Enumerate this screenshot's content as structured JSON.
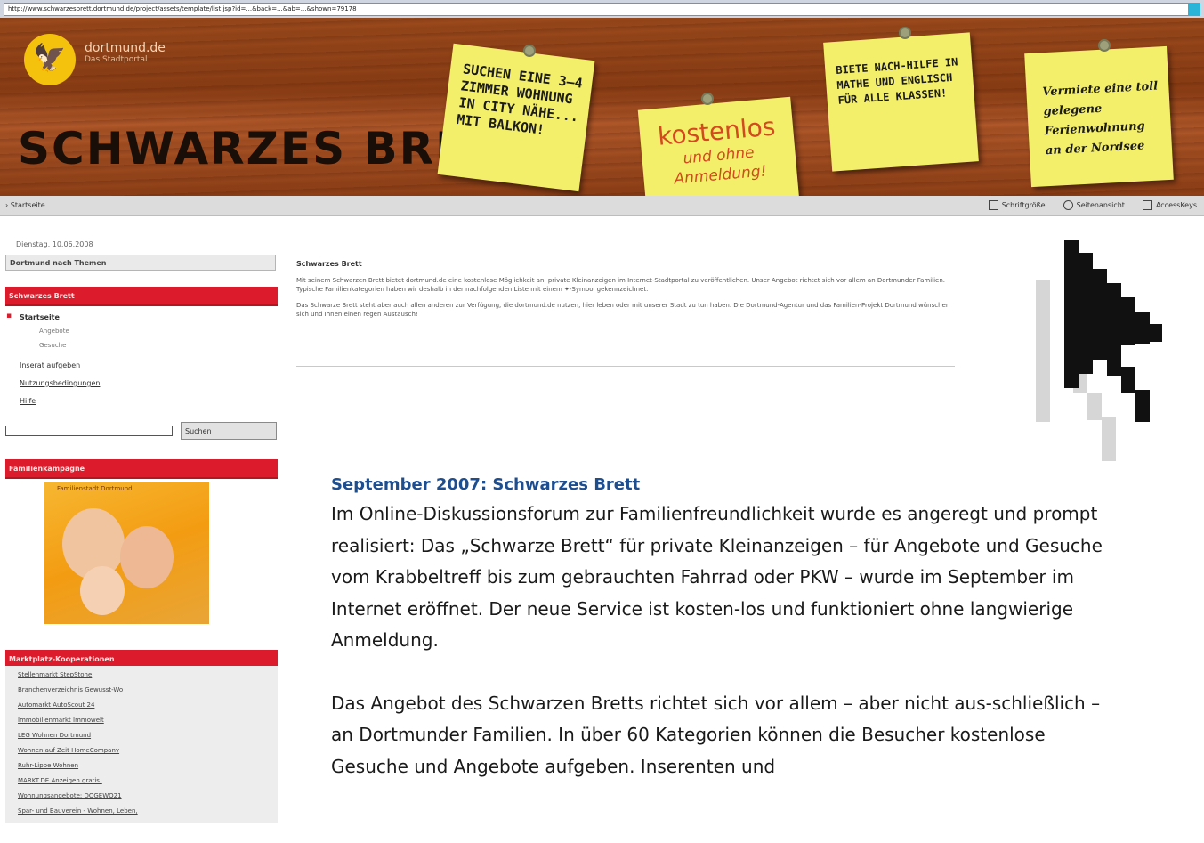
{
  "url": "http://www.schwarzesbrett.dortmund.de/project/assets/template/list.jsp?id=...&back=...&ab=...&shown=79178",
  "banner": {
    "site": "dortmund.de",
    "site_sub": "Das Stadtportal",
    "title": "SCHWARZES BRETT",
    "note1": "SUCHEN EINE 3–4 ZIMMER WOHNUNG IN CITY NÄHE... MIT BALKON!",
    "note2_big": "kostenlos",
    "note2_small": "und ohne Anmeldung!",
    "note3": "BIETE NACH-HILFE IN MATHE UND ENGLISCH FÜR ALLE KLASSEN!",
    "note4": "Vermiete eine toll gelegene Ferienwohnung an der Nordsee"
  },
  "navbar": {
    "home": "› Startseite",
    "font_size": "Schriftgröße",
    "contrast": "Seitenansicht",
    "access": "AccessKeys"
  },
  "left": {
    "date": "Dienstag, 10.06.2008",
    "topics": "Dortmund nach Themen",
    "section": "Schwarzes Brett",
    "nav": [
      "Startseite",
      "Angebote",
      "Gesuche",
      "Inserat aufgeben",
      "Nutzungsbedingungen",
      "Hilfe"
    ],
    "search_button": "Suchen",
    "campaign": "Familienkampagne",
    "campaign_img_label": "Familienstadt Dortmund",
    "market": "Marktplatz-Kooperationen",
    "market_links": [
      "Stellenmarkt StepStone",
      "Branchenverzeichnis Gewusst-Wo",
      "Automarkt AutoScout 24",
      "Immobilienmarkt Immowelt",
      "LEG Wohnen Dortmund",
      "Wohnen auf Zeit HomeCompany",
      "Ruhr-Lippe Wohnen",
      "MARKT.DE Anzeigen gratis!",
      "Wohnungsangebote: DOGEWO21",
      "Spar- und Bauverein - Wohnen, Leben,"
    ]
  },
  "main": {
    "heading": "Schwarzes Brett",
    "para1": "Mit seinem Schwarzen Brett bietet dortmund.de eine kostenlose Möglichkeit an, private Kleinanzeigen im Internet-Stadtportal zu veröffentlichen. Unser Angebot richtet sich vor allem an Dortmunder Familien. Typische Familienkategorien haben wir deshalb in der nachfolgenden Liste mit einem ✦-Symbol gekennzeichnet.",
    "para2": "Das Schwarze Brett steht aber auch allen anderen zur Verfügung, die dortmund.de nutzen, hier leben oder mit unserer Stadt zu tun haben. Die Dortmund-Agentur und das Familien-Projekt Dortmund wünschen sich und Ihnen einen regen Austausch!"
  },
  "article": {
    "heading": "September 2007: Schwarzes Brett",
    "para1": "Im Online-Diskussionsforum zur Familienfreundlichkeit wurde es angeregt und prompt realisiert: Das „Schwarze Brett“ für private Kleinanzeigen – für Angebote und Gesuche vom Krabbeltreff bis zum gebrauchten Fahrrad oder PKW – wurde im September im Internet eröffnet. Der neue Service ist kosten-los und funktioniert ohne langwierige Anmeldung.",
    "para2": "Das Angebot des Schwarzen Bretts richtet sich vor allem – aber nicht aus-schließlich – an Dortmunder Familien. In über 60 Kategorien können die Besucher kostenlose Gesuche und Angebote aufgeben. Inserenten und"
  },
  "colors": {
    "accent_red": "#dc1c2c",
    "heading_blue": "#1d4e8f",
    "note_yellow": "#f4ef6b"
  }
}
